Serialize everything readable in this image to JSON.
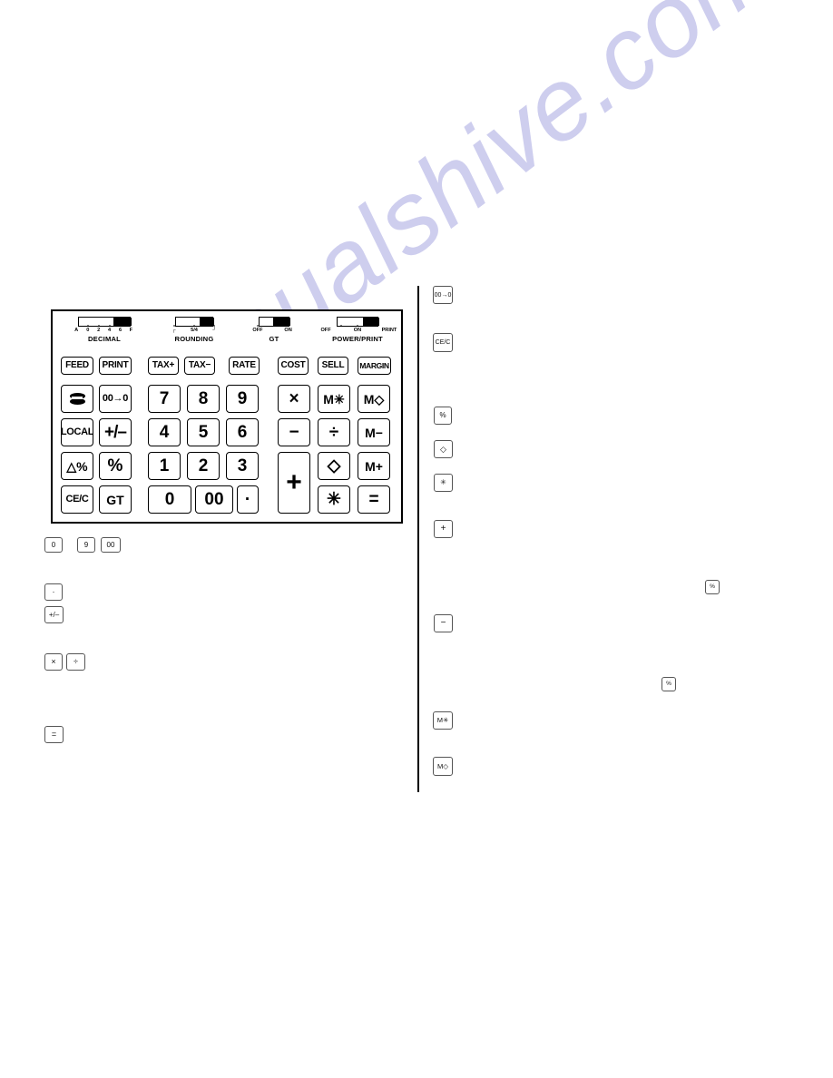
{
  "page": {
    "watermark": "manualshive.com",
    "background_color": "#ffffff",
    "watermark_color": "#ccccee"
  },
  "keypad": {
    "switches": [
      {
        "name": "DECIMAL",
        "ticks": [
          "A",
          "0",
          "2",
          "4",
          "6",
          "F"
        ],
        "position": "right"
      },
      {
        "name": "ROUNDING",
        "ticks": [
          "┌",
          "5/4",
          "┘"
        ],
        "position": "right"
      },
      {
        "name": "GT",
        "ticks": [
          "OFF",
          "ON"
        ],
        "position": "right"
      },
      {
        "name": "POWER/PRINT",
        "ticks": [
          "OFF",
          "ON",
          "PRINT"
        ],
        "position": "middle"
      }
    ],
    "function_row": [
      {
        "label": "FEED",
        "icon": "feed-key"
      },
      {
        "label": "PRINT",
        "icon": "print-key"
      },
      {
        "label": "TAX+",
        "icon": "tax-plus-key"
      },
      {
        "label": "TAX−",
        "icon": "tax-minus-key"
      },
      {
        "label": "RATE",
        "icon": "rate-key"
      },
      {
        "label": "COST",
        "icon": "cost-key"
      },
      {
        "label": "SELL",
        "icon": "sell-key"
      },
      {
        "label": "MARGIN",
        "icon": "margin-key"
      }
    ],
    "main_keys": [
      {
        "label": "",
        "icon": "non-add-key"
      },
      {
        "label": "00→0",
        "icon": "double-zero-to-zero-key"
      },
      {
        "label": "7",
        "icon": "digit-7-key"
      },
      {
        "label": "8",
        "icon": "digit-8-key"
      },
      {
        "label": "9",
        "icon": "digit-9-key"
      },
      {
        "label": "×",
        "icon": "multiply-key"
      },
      {
        "label": "M✳",
        "icon": "memory-total-key"
      },
      {
        "label": "M◇",
        "icon": "memory-subtotal-key"
      },
      {
        "label": "LOCAL",
        "icon": "local-key"
      },
      {
        "label": "+/–",
        "icon": "sign-change-key"
      },
      {
        "label": "4",
        "icon": "digit-4-key"
      },
      {
        "label": "5",
        "icon": "digit-5-key"
      },
      {
        "label": "6",
        "icon": "digit-6-key"
      },
      {
        "label": "−",
        "icon": "minus-key"
      },
      {
        "label": "÷",
        "icon": "divide-key"
      },
      {
        "label": "M−",
        "icon": "memory-minus-key"
      },
      {
        "label": "△%",
        "icon": "delta-percent-key"
      },
      {
        "label": "%",
        "icon": "percent-key"
      },
      {
        "label": "1",
        "icon": "digit-1-key"
      },
      {
        "label": "2",
        "icon": "digit-2-key"
      },
      {
        "label": "3",
        "icon": "digit-3-key"
      },
      {
        "label": "+",
        "icon": "plus-key"
      },
      {
        "label": "◇",
        "icon": "subtotal-key"
      },
      {
        "label": "M+",
        "icon": "memory-plus-key"
      },
      {
        "label": "CE/C",
        "icon": "clear-entry-clear-key"
      },
      {
        "label": "GT",
        "icon": "grand-total-key"
      },
      {
        "label": "0",
        "icon": "digit-0-key"
      },
      {
        "label": "00",
        "icon": "double-zero-key"
      },
      {
        "label": "·",
        "icon": "decimal-point-key"
      },
      {
        "label": "✳",
        "icon": "total-key"
      },
      {
        "label": "=",
        "icon": "equals-key"
      }
    ]
  },
  "reference_keys": {
    "left_column": [
      {
        "label": "0",
        "icon": "digit-0-ref"
      },
      {
        "label": "9",
        "icon": "digit-9-ref"
      },
      {
        "label": "00",
        "icon": "double-zero-ref"
      },
      {
        "label": "·",
        "icon": "decimal-point-ref"
      },
      {
        "label": "+/–",
        "icon": "sign-change-ref"
      },
      {
        "label": "×",
        "icon": "multiply-ref"
      },
      {
        "label": "÷",
        "icon": "divide-ref"
      },
      {
        "label": "=",
        "icon": "equals-ref"
      }
    ],
    "right_column": [
      {
        "label": "00→0",
        "icon": "double-zero-to-zero-ref"
      },
      {
        "label": "CE/C",
        "icon": "clear-entry-clear-ref"
      },
      {
        "label": "%",
        "icon": "percent-ref"
      },
      {
        "label": "◇",
        "icon": "subtotal-ref"
      },
      {
        "label": "✳",
        "icon": "total-ref"
      },
      {
        "label": "+",
        "icon": "plus-ref"
      },
      {
        "label": "−",
        "icon": "minus-ref"
      },
      {
        "label": "M✳",
        "icon": "memory-total-ref"
      },
      {
        "label": "M◇",
        "icon": "memory-subtotal-ref"
      }
    ],
    "inline": [
      {
        "label": "%",
        "icon": "percent-inline-upper"
      },
      {
        "label": "%",
        "icon": "percent-inline-lower"
      }
    ]
  }
}
